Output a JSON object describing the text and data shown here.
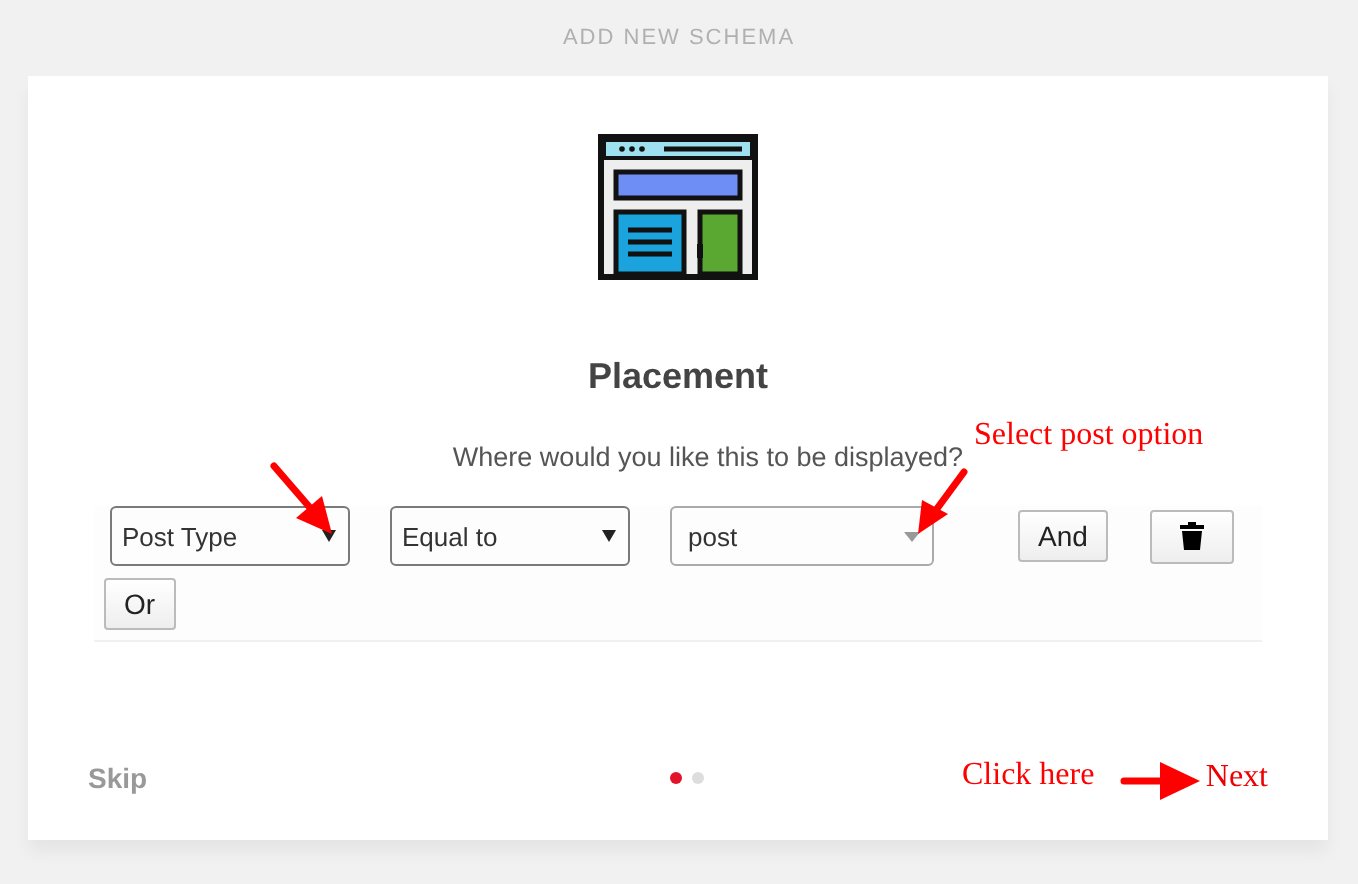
{
  "header": {
    "title": "ADD NEW SCHEMA"
  },
  "step": {
    "title": "Placement",
    "question": "Where would you like this to be displayed?"
  },
  "rule": {
    "fields": [
      {
        "kind": "select",
        "value": "Post Type"
      },
      {
        "kind": "select",
        "value": "Equal to"
      },
      {
        "kind": "combo",
        "value": "post"
      }
    ],
    "and_button": "And",
    "or_button": "Or"
  },
  "footer": {
    "skip": "Skip",
    "pages": [
      {
        "selected": true
      },
      {
        "selected": false
      }
    ],
    "next": "Next"
  },
  "annotations": [
    {
      "kind": "label",
      "text": "Select post option"
    },
    {
      "kind": "label",
      "text": "Click here"
    }
  ]
}
